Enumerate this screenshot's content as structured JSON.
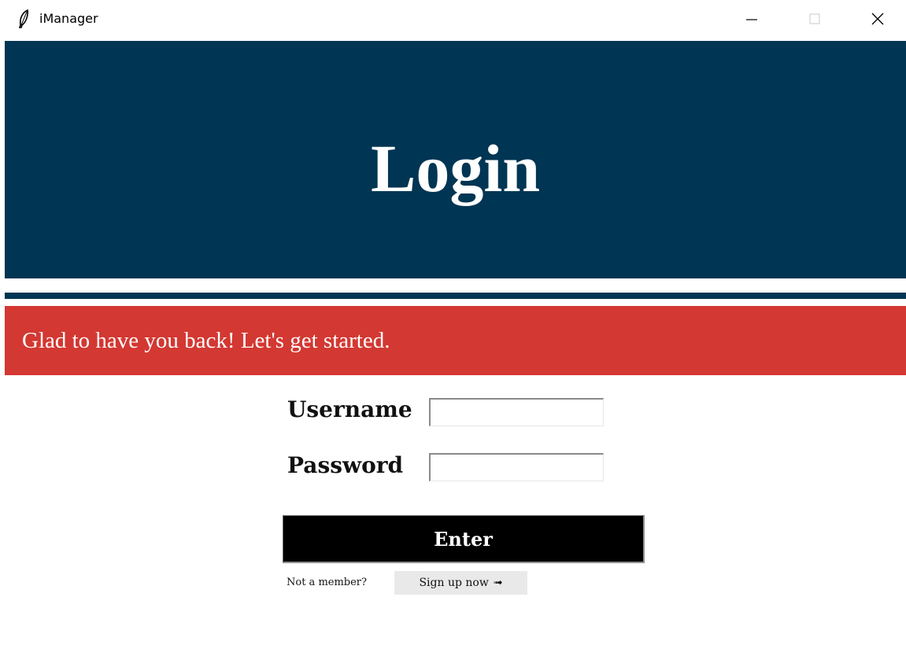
{
  "window": {
    "title": "iManager",
    "icon": "feather-icon",
    "controls": {
      "minimize_icon": "minimize-icon",
      "maximize_icon": "maximize-icon",
      "close_icon": "close-icon"
    }
  },
  "header": {
    "title": "Login",
    "background": "#003553"
  },
  "banner": {
    "text": "Glad to have you back! Let's get started.",
    "background": "#d33832"
  },
  "form": {
    "username_label": "Username",
    "username_value": "",
    "password_label": "Password",
    "password_value": "",
    "enter_label": "Enter"
  },
  "footer": {
    "prompt": "Not a member?",
    "signup_label": "Sign up now",
    "signup_arrow": "➟",
    "signup_icon": "arrow-right-icon"
  }
}
